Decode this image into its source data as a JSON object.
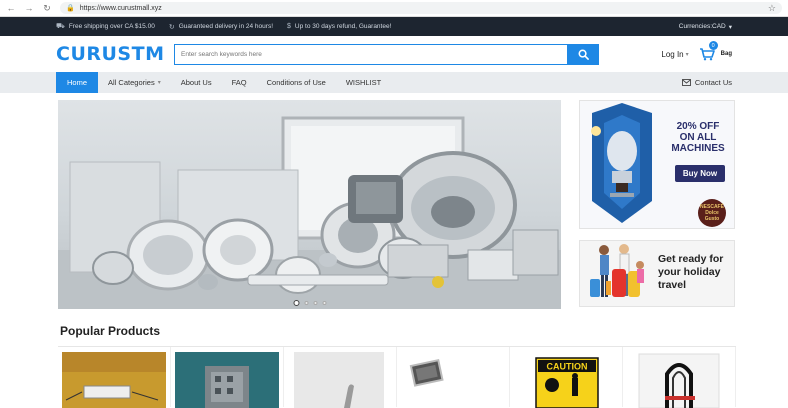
{
  "browser": {
    "url": "https://www.curustmall.xyz"
  },
  "promo": {
    "items": [
      {
        "icon": "truck-icon",
        "text": "Free shipping over CA $15.00"
      },
      {
        "icon": "refresh-icon",
        "text": "Guaranteed delivery in 24 hours!"
      },
      {
        "icon": "dollar-icon",
        "text": "Up to 30 days refund, Guarantee!"
      }
    ],
    "currency": "Currencies:CAD"
  },
  "header": {
    "logo": "CURUSTM",
    "search_placeholder": "Enter search keywords here",
    "login_label": "Log In",
    "bag_count": "0",
    "bag_label": "Bag"
  },
  "nav": {
    "items": [
      "Home",
      "All Categories",
      "About Us",
      "FAQ",
      "Conditions of Use",
      "WISHLIST"
    ],
    "contact_label": "Contact Us"
  },
  "hero": {
    "slides": 4,
    "active_slide": 1
  },
  "ads": {
    "machines": {
      "line1": "20% OFF",
      "line2": "ON ALL",
      "line3": "MACHINES",
      "button": "Buy Now",
      "brand": "NESCAFÉ Dolce Gusto"
    },
    "holiday": {
      "text": "Get ready for your holiday travel"
    }
  },
  "popular": {
    "title": "Popular Products"
  },
  "colors": {
    "accent": "#1e88e5",
    "promo_bg": "#1d2530",
    "nav_bg": "#e9ecef"
  }
}
